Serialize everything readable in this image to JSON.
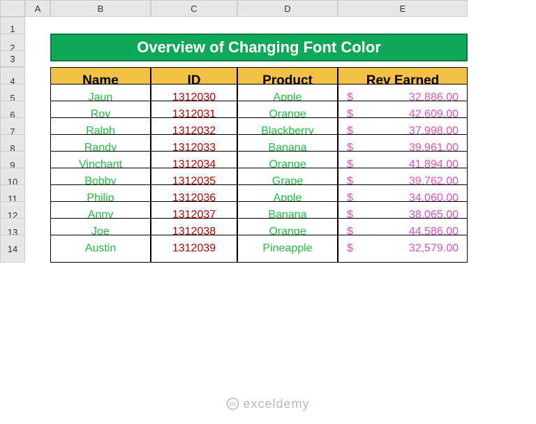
{
  "columns": [
    "A",
    "B",
    "C",
    "D",
    "E"
  ],
  "rows": [
    "1",
    "2",
    "3",
    "4",
    "5",
    "6",
    "7",
    "8",
    "9",
    "10",
    "11",
    "12",
    "13",
    "14"
  ],
  "banner": "Overview of Changing Font Color",
  "headers": {
    "name": "Name",
    "id": "ID",
    "product": "Product",
    "rev": "Rev Earned"
  },
  "watermark": "exceldemy",
  "chart_data": {
    "type": "table",
    "columns": [
      "Name",
      "ID",
      "Product",
      "Rev Earned"
    ],
    "rows": [
      {
        "name": "Jaun",
        "id": "1312030",
        "product": "Apple",
        "rev": "32,886.00"
      },
      {
        "name": "Roy",
        "id": "1312031",
        "product": "Orange",
        "rev": "42,609.00"
      },
      {
        "name": "Ralph",
        "id": "1312032",
        "product": "Blackberry",
        "rev": "37,998.00"
      },
      {
        "name": "Randy",
        "id": "1312033",
        "product": "Banana",
        "rev": "39,961.00"
      },
      {
        "name": "Vinchant",
        "id": "1312034",
        "product": "Orange",
        "rev": "41,894.00"
      },
      {
        "name": "Bobby",
        "id": "1312035",
        "product": "Grape",
        "rev": "39,762.00"
      },
      {
        "name": "Philip",
        "id": "1312036",
        "product": "Apple",
        "rev": "34,060.00"
      },
      {
        "name": "Anny",
        "id": "1312037",
        "product": "Banana",
        "rev": "38,065.00"
      },
      {
        "name": "Joe",
        "id": "1312038",
        "product": "Orange",
        "rev": "44,586.00"
      },
      {
        "name": "Austin",
        "id": "1312039",
        "product": "Pineapple",
        "rev": "32,579.00"
      }
    ]
  },
  "currency": "$"
}
